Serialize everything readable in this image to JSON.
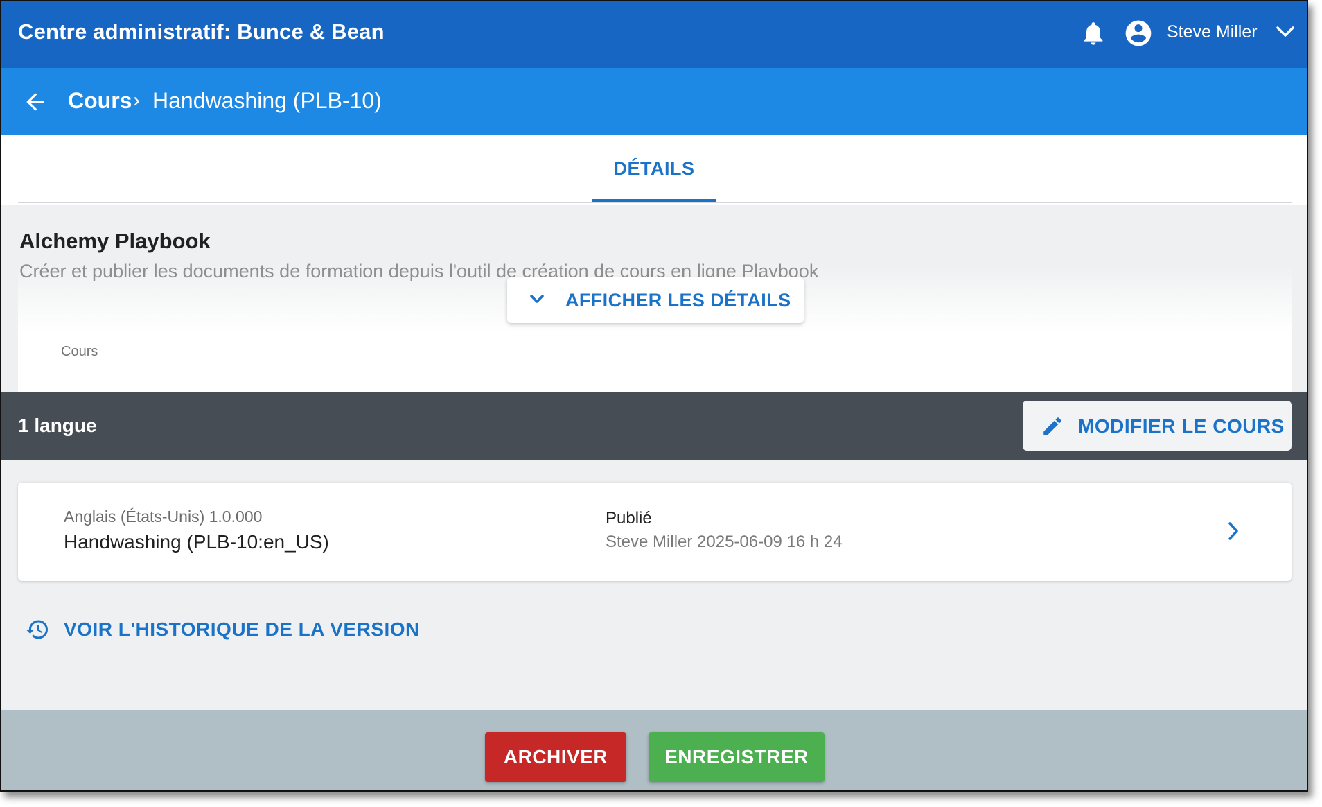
{
  "header": {
    "app_title": "Centre administratif: Bunce & Bean",
    "user_name": "Steve Miller",
    "icons": [
      "bell-icon",
      "account-circle-icon",
      "chevron-down-icon"
    ]
  },
  "breadcrumb": {
    "parent": "Cours",
    "separator": "›",
    "current": "Handwashing (PLB-10)"
  },
  "tabs": [
    {
      "label": "DÉTAILS",
      "active": true
    }
  ],
  "description": {
    "product_name": "Alchemy Playbook",
    "text": "Créer et publier les documents de formation depuis l'outil de création de cours en ligne Playbook",
    "show_details_label": "AFFICHER LES DÉTAILS",
    "type_label": "Cours"
  },
  "languages": {
    "count_label": "1 langue",
    "edit_label": "MODIFIER LE COURS",
    "items": [
      {
        "locale_version": "Anglais (États-Unis) 1.0.000",
        "course_name": "Handwashing (PLB-10:en_US)",
        "status": "Publié",
        "meta": "Steve Miller 2025-06-09 16 h 24"
      }
    ]
  },
  "history": {
    "label": "VOIR L'HISTORIQUE DE LA VERSION"
  },
  "footer": {
    "archive_label": "ARCHIVER",
    "save_label": "ENREGISTRER"
  },
  "colors": {
    "top_bar": "#1866c3",
    "breadcrumb_bar": "#1e88e5",
    "accent": "#1a73c9",
    "section_header": "#474d54",
    "archive": "#c62828",
    "save": "#4caf50",
    "footer": "#b0bec5"
  }
}
